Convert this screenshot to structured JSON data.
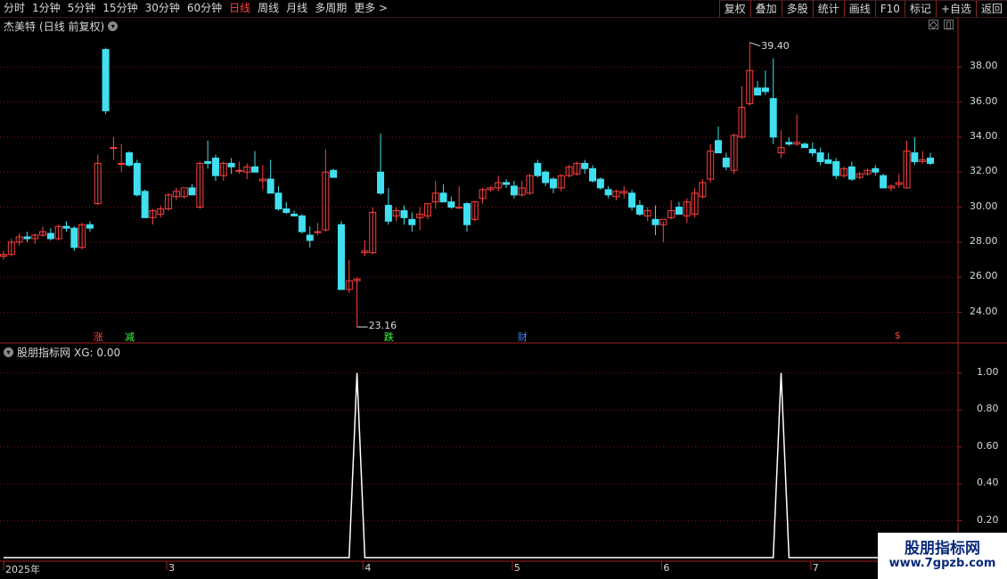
{
  "toolbar": {
    "periods": [
      "分时",
      "1分钟",
      "5分钟",
      "15分钟",
      "30分钟",
      "60分钟",
      "日线",
      "周线",
      "月线",
      "多周期",
      "更多 >"
    ],
    "active_period": "日线",
    "buttons": [
      "复权",
      "叠加",
      "多股",
      "统计",
      "画线",
      "F10",
      "标记",
      "+自选",
      "返回"
    ]
  },
  "main_panel": {
    "stock_name": "杰美特",
    "mode": "(日线 前复权)",
    "high_label": "39.40",
    "low_label": "23.16",
    "markers": [
      {
        "text": "涨",
        "color": "#ff4040"
      },
      {
        "text": "减",
        "color": "#40ff40"
      },
      {
        "text": "跌",
        "color": "#40ff40"
      },
      {
        "text": "财",
        "color": "#4080ff"
      },
      {
        "text": "$",
        "color": "#ff4040"
      }
    ]
  },
  "indicator_panel": {
    "title": "股朋指标网",
    "value_label": "XG: 0.00"
  },
  "colors": {
    "up": "#ff4040",
    "down": "#40e0f0",
    "grid": "#7a1010",
    "line": "#ffffff"
  },
  "chart_data": [
    {
      "type": "candlestick",
      "title": "杰美特 (日线 前复权)",
      "y_ticks": [
        "38.00",
        "36.00",
        "34.00",
        "32.00",
        "30.00",
        "28.00",
        "26.00",
        "24.00"
      ],
      "ylim": [
        22.4,
        40.3
      ],
      "ohlc": [
        [
          27.2,
          27.5,
          27.0,
          27.3
        ],
        [
          27.3,
          28.2,
          27.2,
          28.0
        ],
        [
          28.0,
          28.5,
          27.8,
          28.3
        ],
        [
          28.3,
          28.6,
          28.0,
          28.2
        ],
        [
          28.2,
          28.5,
          27.9,
          28.4
        ],
        [
          28.4,
          28.9,
          28.3,
          28.6
        ],
        [
          28.5,
          28.8,
          28.1,
          28.2
        ],
        [
          28.2,
          29.0,
          28.1,
          28.9
        ],
        [
          28.9,
          29.2,
          28.6,
          28.8
        ],
        [
          28.8,
          28.9,
          27.5,
          27.7
        ],
        [
          27.7,
          29.1,
          27.6,
          29.0
        ],
        [
          29.0,
          29.2,
          28.6,
          28.8
        ],
        [
          30.2,
          33.0,
          30.1,
          32.5
        ],
        [
          39.0,
          39.1,
          35.3,
          35.5
        ],
        [
          33.4,
          34.0,
          32.7,
          33.4
        ],
        [
          32.5,
          33.6,
          32.0,
          32.5
        ],
        [
          33.1,
          33.2,
          32.3,
          32.4
        ],
        [
          32.5,
          32.7,
          30.6,
          30.7
        ],
        [
          30.9,
          31.0,
          29.4,
          29.4
        ],
        [
          29.4,
          29.9,
          29.0,
          29.8
        ],
        [
          29.6,
          30.1,
          29.4,
          29.9
        ],
        [
          29.9,
          30.8,
          29.8,
          30.7
        ],
        [
          30.6,
          31.1,
          30.4,
          30.9
        ],
        [
          30.6,
          31.0,
          30.5,
          31.1
        ],
        [
          31.1,
          31.3,
          30.7,
          30.7
        ],
        [
          30.0,
          32.6,
          29.9,
          32.5
        ],
        [
          32.6,
          33.8,
          32.2,
          32.5
        ],
        [
          32.8,
          33.0,
          31.5,
          31.8
        ],
        [
          31.8,
          32.6,
          31.5,
          32.5
        ],
        [
          32.5,
          32.8,
          31.9,
          32.3
        ],
        [
          32.1,
          32.6,
          31.9,
          32.1
        ],
        [
          32.0,
          32.5,
          31.6,
          32.3
        ],
        [
          32.3,
          33.2,
          32.1,
          32.0
        ],
        [
          31.5,
          32.4,
          31.0,
          31.6
        ],
        [
          31.6,
          32.7,
          31.4,
          30.8
        ],
        [
          30.8,
          31.2,
          29.8,
          29.9
        ],
        [
          29.9,
          30.3,
          29.6,
          29.7
        ],
        [
          29.6,
          29.8,
          29.5,
          29.5
        ],
        [
          29.5,
          29.6,
          28.5,
          28.6
        ],
        [
          28.4,
          28.9,
          27.7,
          28.1
        ],
        [
          28.6,
          29.1,
          28.4,
          28.6
        ],
        [
          28.7,
          33.3,
          28.6,
          32.0
        ],
        [
          32.1,
          32.2,
          31.7,
          31.7
        ],
        [
          29.0,
          29.2,
          25.4,
          25.3
        ],
        [
          25.3,
          27.0,
          25.1,
          25.8
        ],
        [
          25.8,
          26.0,
          23.16,
          25.9
        ],
        [
          27.4,
          28.1,
          27.2,
          27.5
        ],
        [
          27.4,
          30.0,
          27.3,
          29.7
        ],
        [
          32.0,
          34.2,
          30.7,
          30.8
        ],
        [
          30.1,
          31.1,
          29.0,
          29.2
        ],
        [
          29.5,
          30.0,
          29.2,
          29.8
        ],
        [
          29.8,
          30.1,
          29.0,
          29.4
        ],
        [
          29.3,
          29.7,
          28.6,
          29.0
        ],
        [
          29.4,
          30.0,
          28.7,
          29.6
        ],
        [
          29.5,
          30.2,
          29.3,
          30.2
        ],
        [
          30.3,
          31.5,
          29.9,
          30.8
        ],
        [
          30.8,
          31.3,
          30.3,
          30.3
        ],
        [
          30.3,
          30.6,
          29.9,
          30.0
        ],
        [
          30.0,
          31.2,
          29.9,
          30.0
        ],
        [
          30.2,
          30.3,
          28.6,
          29.0
        ],
        [
          29.3,
          30.3,
          29.2,
          30.3
        ],
        [
          30.5,
          31.1,
          30.2,
          31.0
        ],
        [
          31.0,
          31.2,
          30.9,
          31.1
        ],
        [
          31.1,
          31.8,
          30.9,
          31.4
        ],
        [
          31.4,
          31.6,
          31.1,
          31.3
        ],
        [
          31.2,
          31.5,
          30.5,
          30.7
        ],
        [
          30.7,
          31.5,
          30.6,
          31.1
        ],
        [
          30.8,
          31.9,
          30.7,
          31.8
        ],
        [
          32.5,
          32.7,
          31.7,
          31.8
        ],
        [
          32.0,
          32.1,
          31.2,
          31.4
        ],
        [
          31.6,
          31.7,
          30.8,
          31.1
        ],
        [
          31.1,
          31.9,
          30.9,
          31.8
        ],
        [
          31.8,
          32.4,
          31.7,
          32.3
        ],
        [
          31.9,
          32.6,
          31.8,
          32.5
        ],
        [
          32.5,
          32.7,
          31.9,
          32.2
        ],
        [
          32.2,
          32.4,
          31.4,
          31.5
        ],
        [
          31.6,
          31.7,
          31.0,
          31.1
        ],
        [
          31.0,
          31.2,
          30.5,
          30.7
        ],
        [
          30.6,
          31.0,
          30.4,
          30.9
        ],
        [
          30.8,
          31.2,
          30.5,
          30.9
        ],
        [
          30.8,
          31.0,
          29.8,
          30.0
        ],
        [
          30.1,
          30.4,
          29.5,
          29.6
        ],
        [
          29.5,
          30.0,
          29.2,
          29.8
        ],
        [
          29.3,
          30.1,
          28.4,
          29.0
        ],
        [
          29.0,
          29.2,
          28.0,
          29.3
        ],
        [
          29.4,
          30.4,
          29.3,
          29.8
        ],
        [
          30.0,
          30.3,
          29.6,
          29.6
        ],
        [
          29.5,
          30.5,
          29.1,
          30.3
        ],
        [
          29.6,
          31.1,
          29.4,
          30.8
        ],
        [
          30.6,
          31.6,
          30.5,
          31.4
        ],
        [
          31.6,
          33.6,
          31.4,
          33.2
        ],
        [
          33.8,
          34.6,
          33.7,
          33.1
        ],
        [
          32.8,
          33.1,
          32.1,
          32.3
        ],
        [
          32.1,
          34.2,
          31.9,
          34.1
        ],
        [
          34.0,
          36.9,
          33.9,
          35.7
        ],
        [
          35.9,
          39.4,
          35.8,
          37.8
        ],
        [
          36.8,
          37.2,
          36.5,
          36.4
        ],
        [
          36.8,
          37.8,
          36.4,
          36.6
        ],
        [
          36.2,
          38.5,
          33.6,
          34.0
        ],
        [
          33.1,
          34.4,
          32.8,
          33.4
        ],
        [
          33.7,
          34.0,
          33.5,
          33.6
        ],
        [
          33.6,
          35.3,
          33.5,
          33.7
        ],
        [
          33.6,
          33.7,
          33.4,
          33.4
        ],
        [
          33.3,
          33.7,
          32.9,
          33.1
        ],
        [
          33.1,
          33.4,
          32.4,
          32.6
        ],
        [
          32.7,
          33.1,
          32.5,
          32.5
        ],
        [
          32.6,
          32.8,
          31.6,
          31.8
        ],
        [
          31.8,
          32.3,
          31.7,
          32.2
        ],
        [
          32.3,
          32.6,
          31.5,
          31.6
        ],
        [
          31.7,
          32.0,
          31.6,
          31.9
        ],
        [
          31.9,
          32.2,
          31.8,
          32.1
        ],
        [
          32.2,
          32.4,
          31.8,
          32.0
        ],
        [
          31.8,
          31.9,
          31.1,
          31.1
        ],
        [
          31.1,
          31.3,
          30.9,
          31.2
        ],
        [
          31.3,
          31.9,
          31.1,
          31.4
        ],
        [
          31.1,
          33.8,
          31.1,
          33.2
        ],
        [
          33.1,
          34.0,
          32.4,
          32.6
        ],
        [
          32.6,
          33.2,
          32.5,
          32.7
        ],
        [
          32.8,
          33.1,
          32.4,
          32.5
        ]
      ]
    },
    {
      "type": "line",
      "title": "股朋指标网",
      "series": [
        {
          "name": "XG",
          "values": []
        }
      ],
      "y_ticks": [
        "1.00",
        "0.80",
        "0.60",
        "0.40",
        "0.20"
      ],
      "ylim": [
        0,
        1.1
      ],
      "spikes_at_index": [
        45,
        99
      ],
      "x_labels": [
        "2025年",
        "3",
        "4",
        "5",
        "6",
        "7"
      ]
    }
  ]
}
